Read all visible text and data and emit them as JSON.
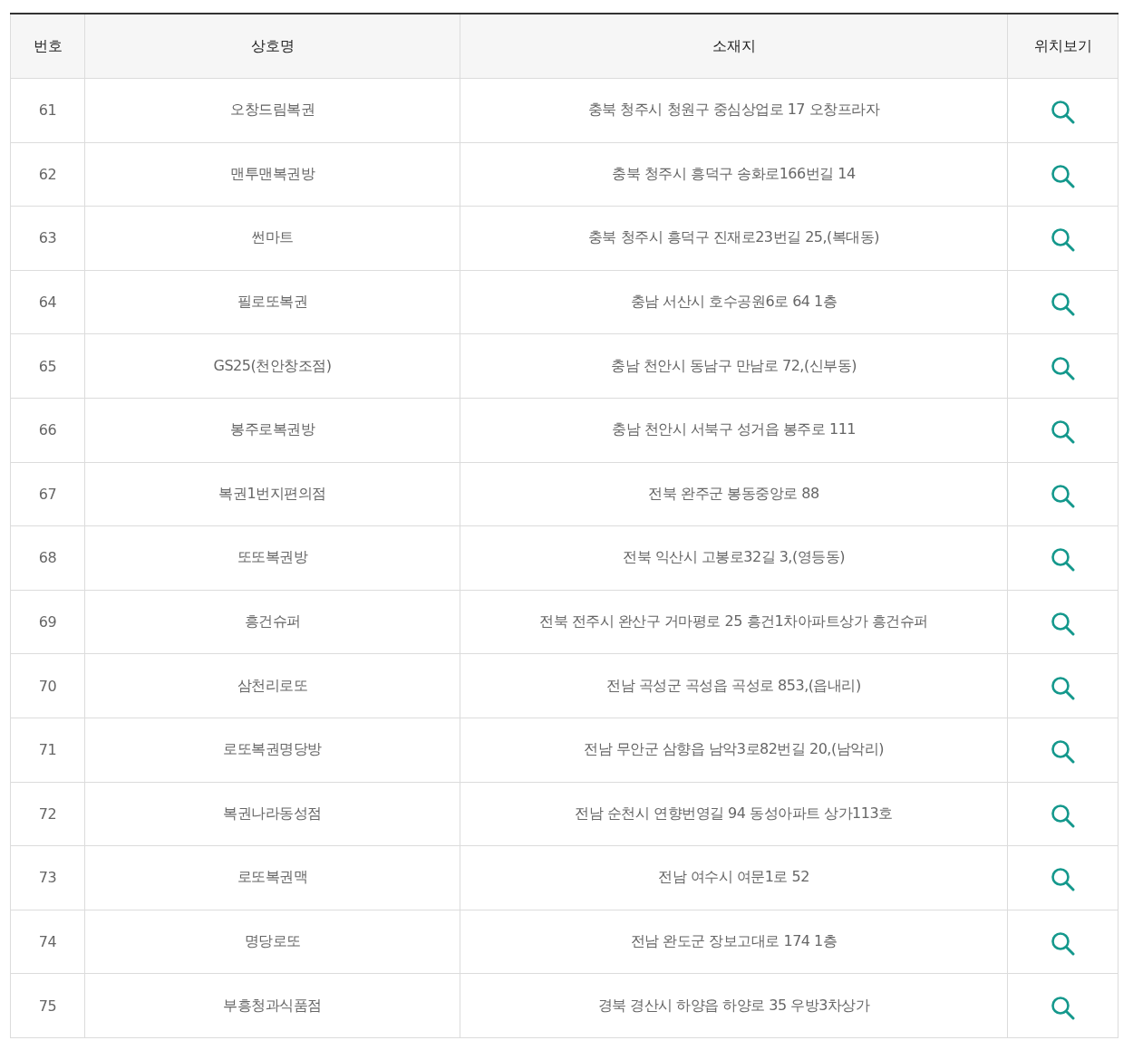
{
  "table": {
    "columns": [
      "번호",
      "상호명",
      "소재지",
      "위치보기"
    ],
    "rows": [
      {
        "number": "61",
        "name": "오창드림복권",
        "address": "충북 청주시 청원구 중심상업로 17 오창프라자"
      },
      {
        "number": "62",
        "name": "맨투맨복권방",
        "address": "충북 청주시 흥덕구 송화로166번길 14"
      },
      {
        "number": "63",
        "name": "썬마트",
        "address": "충북 청주시 흥덕구 진재로23번길 25,(복대동)"
      },
      {
        "number": "64",
        "name": "필로또복권",
        "address": "충남 서산시 호수공원6로 64 1층"
      },
      {
        "number": "65",
        "name": "GS25(천안창조점)",
        "address": "충남 천안시 동남구 만남로 72,(신부동)"
      },
      {
        "number": "66",
        "name": "봉주로복권방",
        "address": "충남 천안시 서북구 성거읍 봉주로 111"
      },
      {
        "number": "67",
        "name": "복권1번지편의점",
        "address": "전북 완주군 봉동중앙로 88"
      },
      {
        "number": "68",
        "name": "또또복권방",
        "address": "전북 익산시 고봉로32길 3,(영등동)"
      },
      {
        "number": "69",
        "name": "흥건슈퍼",
        "address": "전북 전주시 완산구 거마평로 25 흥건1차아파트상가 흥건슈퍼"
      },
      {
        "number": "70",
        "name": "삼천리로또",
        "address": "전남 곡성군 곡성읍 곡성로 853,(읍내리)"
      },
      {
        "number": "71",
        "name": "로또복권명당방",
        "address": "전남 무안군 삼향읍 남악3로82번길 20,(남악리)"
      },
      {
        "number": "72",
        "name": "복권나라동성점",
        "address": "전남 순천시 연향번영길 94 동성아파트 상가113호"
      },
      {
        "number": "73",
        "name": "로또복권맥",
        "address": "전남 여수시 여문1로 52"
      },
      {
        "number": "74",
        "name": "명당로또",
        "address": "전남 완도군 장보고대로 174 1층"
      },
      {
        "number": "75",
        "name": "부흥청과식품점",
        "address": "경북 경산시 하양읍 하양로 35 우방3차상가"
      }
    ]
  }
}
